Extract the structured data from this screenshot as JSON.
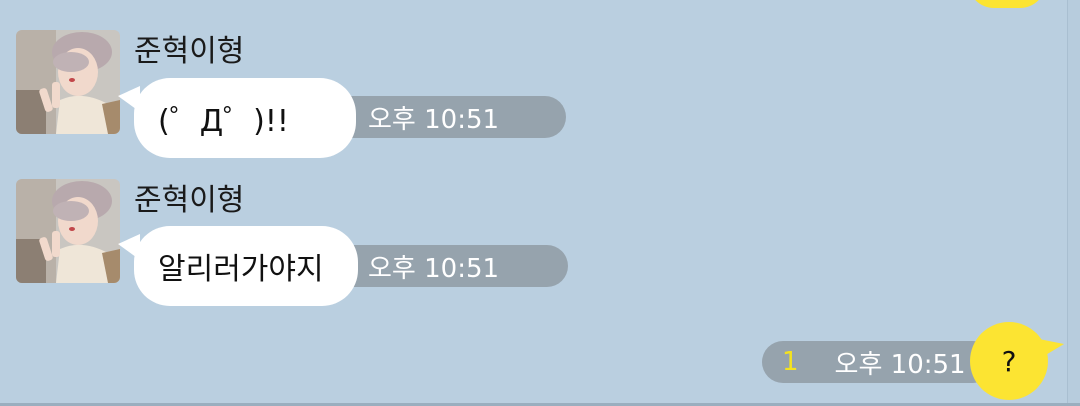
{
  "messages": [
    {
      "sender": "준혁이형",
      "text": "(゜Д゜)!!",
      "time": "오후 10:51"
    },
    {
      "sender": "준혁이형",
      "text": "알리러가야지",
      "time": "오후 10:51"
    }
  ],
  "my_message": {
    "text": "?",
    "time": "오후 10:51",
    "unread_count": "1"
  },
  "colors": {
    "background": "#bacfe0",
    "my_bubble": "#fce432",
    "their_bubble": "#ffffff",
    "time_pill": "#96a3ad",
    "unread": "#f4e21f"
  },
  "icons": {
    "avatar": "profile-photo"
  }
}
